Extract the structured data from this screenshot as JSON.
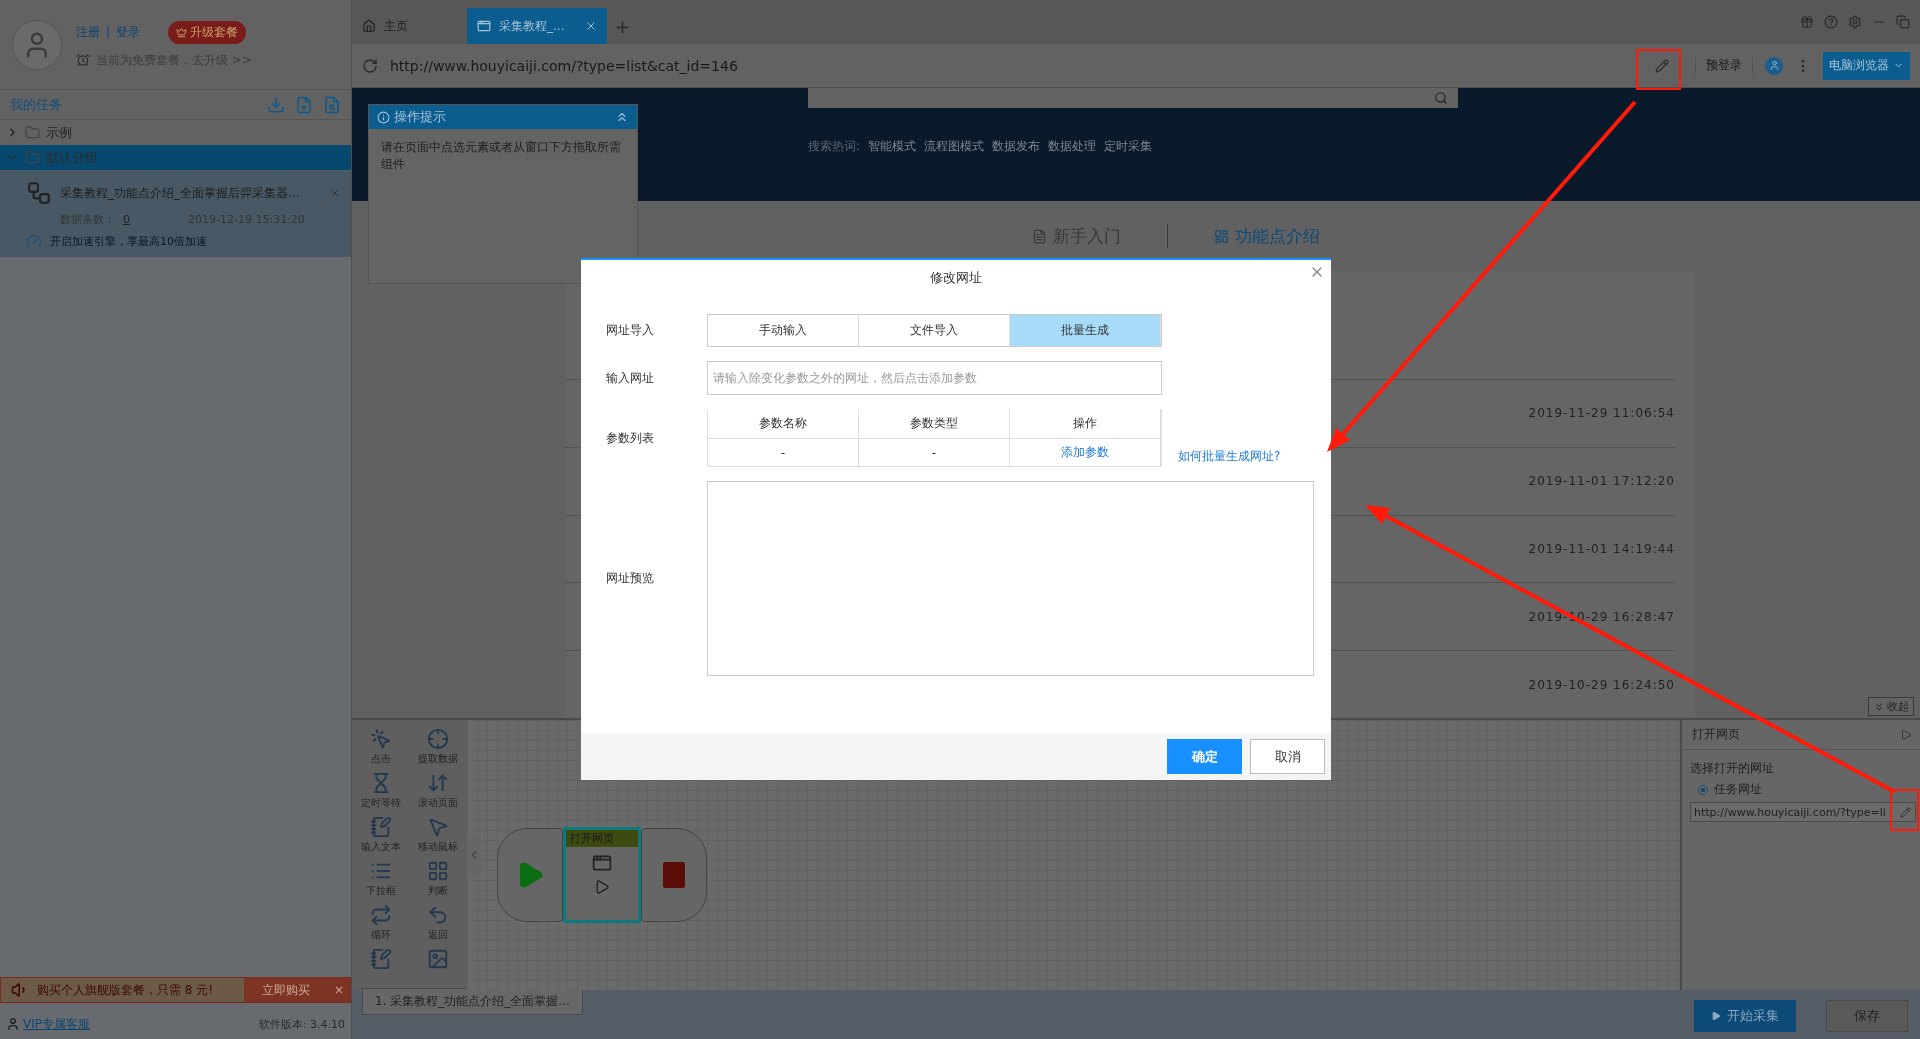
{
  "user": {
    "links": [
      "注册",
      "登录"
    ],
    "separator": "|",
    "upgrade": "升级套餐",
    "plan_note": "当前为免费套餐，去升级 >>"
  },
  "tasks": {
    "title": "我的任务",
    "groups": [
      {
        "name": "示例",
        "expanded": false,
        "selected": false
      },
      {
        "name": "默认分组",
        "expanded": true,
        "selected": true,
        "children": [
          {
            "name": "采集教程_功能点介绍_全面掌握后羿采集器...",
            "count_label": "数据条数：",
            "count": "0",
            "time": "2019-12-19 15:31:20",
            "boost": "开启加速引擎，享最高10倍加速"
          }
        ]
      }
    ]
  },
  "promo": {
    "text": "购买个人旗舰版套餐，只需 8 元!",
    "action": "立即购买",
    "close": "×"
  },
  "footer": {
    "support": "VIP专属客服",
    "version": "软件版本: 3.4.10"
  },
  "tabs": [
    {
      "label": "主页",
      "kind": "home",
      "selected": false
    },
    {
      "label": "采集教程_...",
      "kind": "page",
      "selected": true
    }
  ],
  "new_tab": "+",
  "address": {
    "url": "http://www.houyicaiji.com/?type=list&cat_id=146",
    "prelogin": "预登录",
    "browser_mode": "电脑浏览器"
  },
  "hint": {
    "title": "操作提示",
    "text": "请在页面中点选元素或者从窗口下方拖取所需组件"
  },
  "web": {
    "hot_label": "搜索热词:",
    "hot_words": [
      "智能模式",
      "流程图模式",
      "数据发布",
      "数据处理",
      "定时采集"
    ],
    "sections": [
      {
        "label": "新手入门",
        "selected": false
      },
      {
        "label": "功能点介绍",
        "selected": true
      }
    ],
    "dates": [
      "2019-11-29 11:06:54",
      "2019-11-01 17:12:20",
      "2019-11-01 14:19:44",
      "2019-10-29 16:28:47",
      "2019-10-29 16:24:50"
    ],
    "collapse": "收起"
  },
  "components": [
    "点击",
    "提取数据",
    "定时等待",
    "滚动页面",
    "输入文本",
    "移动鼠标",
    "下拉框",
    "判断",
    "循环",
    "返回"
  ],
  "flow": {
    "node_title": "打开网页"
  },
  "step_tab": "1. 采集教程_功能点介绍_全面掌握...",
  "props": {
    "title": "打开网页",
    "label": "选择打开的网址",
    "options": [
      {
        "label": "任务网址",
        "selected": true
      }
    ],
    "url": "http://www.houyicaiji.com/?type=li"
  },
  "actions": [
    {
      "label": "开始采集",
      "kind": "primary"
    },
    {
      "label": "保存",
      "kind": "secondary"
    }
  ],
  "dialog": {
    "title": "修改网址",
    "import_label": "网址导入",
    "modes": [
      {
        "label": "手动输入",
        "selected": false
      },
      {
        "label": "文件导入",
        "selected": false
      },
      {
        "label": "批量生成",
        "selected": true
      }
    ],
    "url_label": "输入网址",
    "url_placeholder": "请输入除变化参数之外的网址，然后点击添加参数",
    "params_label": "参数列表",
    "params_columns": [
      "参数名称",
      "参数类型",
      "操作"
    ],
    "params_row": [
      "-",
      "-",
      "添加参数"
    ],
    "help_link": "如何批量生成网址?",
    "preview_label": "网址预览",
    "buttons": [
      {
        "label": "确定",
        "kind": "primary"
      },
      {
        "label": "取消",
        "kind": "secondary"
      }
    ]
  }
}
